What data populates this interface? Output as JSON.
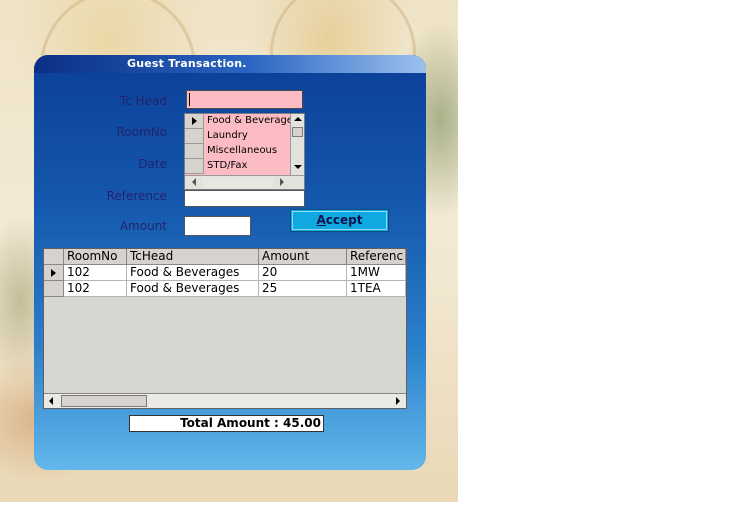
{
  "window": {
    "title": "Guest Transaction."
  },
  "form": {
    "labels": {
      "tc_head": "Tc Head",
      "room_no": "RoomNo",
      "date": "Date",
      "reference": "Reference",
      "amount": "Amount"
    },
    "tc_head_value": "",
    "reference_value": "",
    "amount_value": "",
    "dropdown_items": [
      "Food & Beverages",
      "Laundry",
      "Miscellaneous",
      "STD/Fax"
    ],
    "accept_label_hotkey": "A",
    "accept_label_rest": "ccept"
  },
  "grid": {
    "columns": [
      "RoomNo",
      "TcHead",
      "Amount",
      "Referenc"
    ],
    "rows": [
      {
        "room_no": "102",
        "tc_head": "Food & Beverages",
        "amount": "20",
        "reference": "1MW"
      },
      {
        "room_no": "102",
        "tc_head": "Food & Beverages",
        "amount": "25",
        "reference": "1TEA"
      }
    ]
  },
  "total": {
    "text": "Total Amount : 45.00"
  },
  "colors": {
    "panel_top": "#0c3f97",
    "panel_bottom": "#63b7ea",
    "input_pink": "#fdbcc3",
    "accept_button": "#0fa8e0",
    "label_text": "#24236b"
  }
}
